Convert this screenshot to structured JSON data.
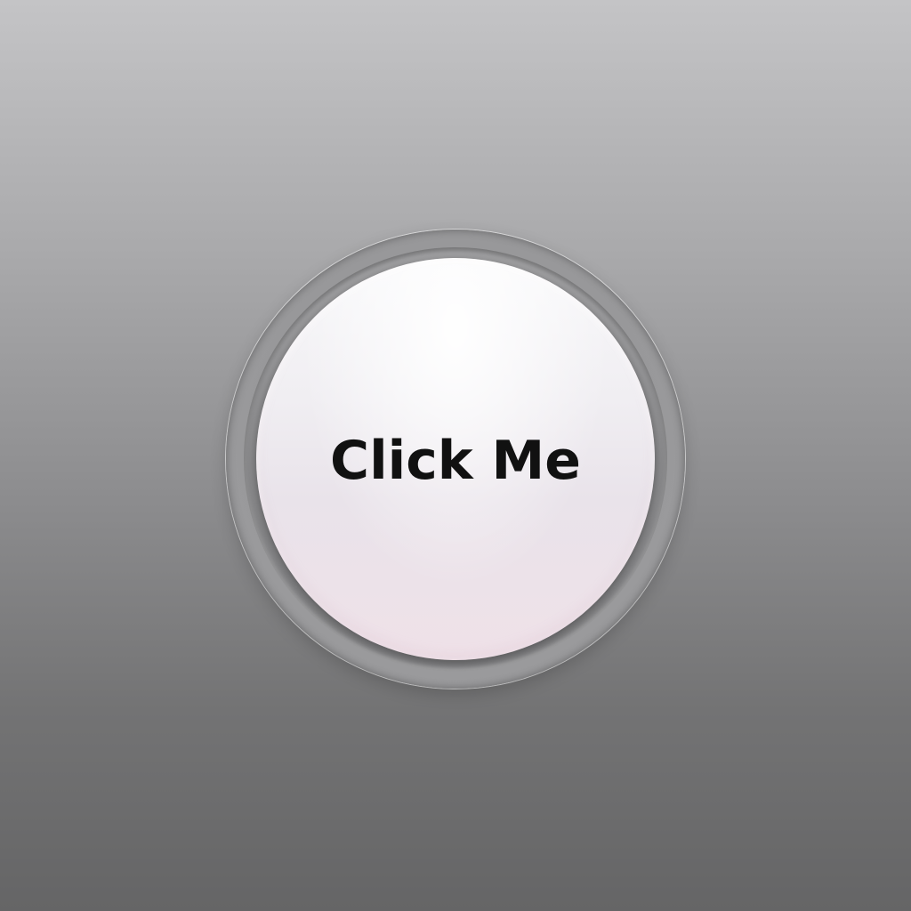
{
  "button": {
    "label": "Click Me"
  },
  "colors": {
    "background_top": "#c4c4c6",
    "background_bottom": "#656566",
    "button_face": "#f0eef2",
    "button_ring": "#9c9c9e",
    "label": "#111111"
  }
}
